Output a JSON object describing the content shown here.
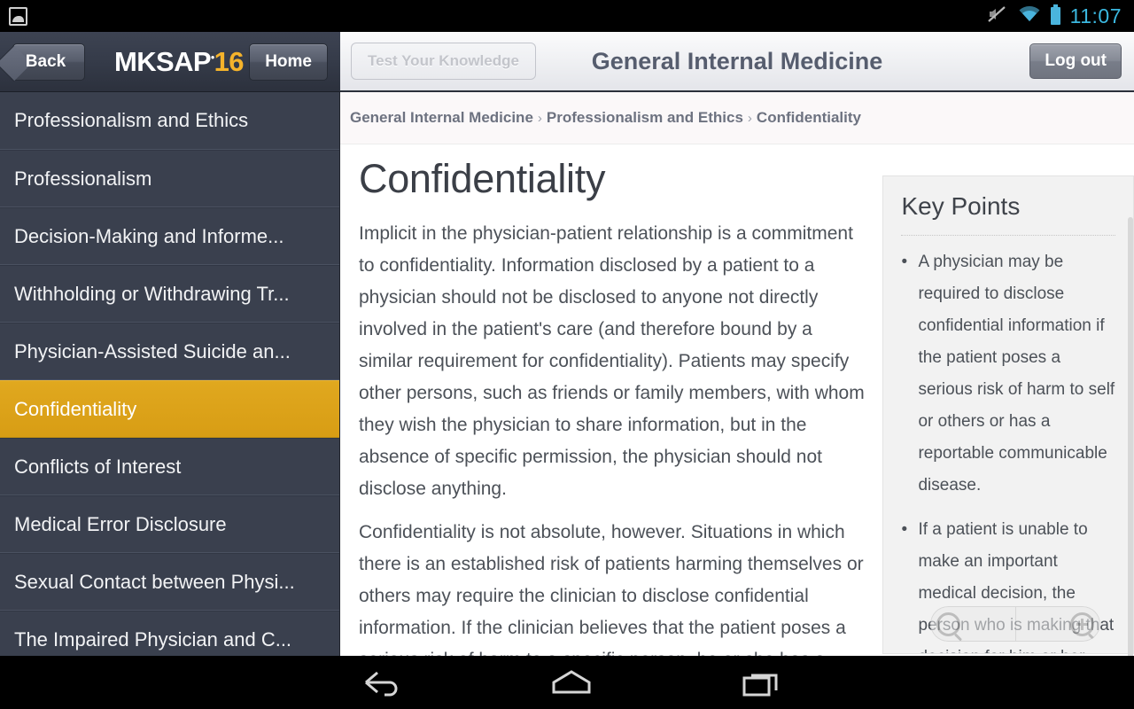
{
  "status_bar": {
    "notification_icon": "image-notification-icon",
    "vibrate_icon": "vibrate-mute-icon",
    "wifi_icon": "wifi-icon",
    "battery_icon": "battery-icon",
    "time": "11:07"
  },
  "app_bar": {
    "back_label": "Back",
    "logo_main": "MKSAP",
    "logo_tm": "•",
    "logo_edition": "16",
    "home_label": "Home",
    "test_your_knowledge_label": "Test Your Knowledge",
    "title": "General Internal Medicine",
    "logout_label": "Log out"
  },
  "sidebar": {
    "items": [
      {
        "label": "Professionalism and Ethics",
        "active": false
      },
      {
        "label": "Professionalism",
        "active": false
      },
      {
        "label": "Decision-Making and Informe...",
        "active": false
      },
      {
        "label": "Withholding or Withdrawing Tr...",
        "active": false
      },
      {
        "label": "Physician-Assisted Suicide an...",
        "active": false
      },
      {
        "label": "Confidentiality",
        "active": true
      },
      {
        "label": "Conflicts of Interest",
        "active": false
      },
      {
        "label": "Medical Error Disclosure",
        "active": false
      },
      {
        "label": "Sexual Contact between Physi...",
        "active": false
      },
      {
        "label": "The Impaired Physician and C...",
        "active": false
      }
    ]
  },
  "breadcrumb": {
    "separator": "›",
    "items": [
      "General Internal Medicine",
      "Professionalism and Ethics",
      "Confidentiality"
    ]
  },
  "article": {
    "title": "Confidentiality",
    "paragraphs": [
      "Implicit in the physician-patient relationship is a commitment to confidentiality. Information disclosed by a patient to a physician should not be disclosed to anyone not directly involved in the patient's care (and therefore bound by a similar requirement for confidentiality). Patients may specify other persons, such as friends or family members, with whom they wish the physician to share information, but in the absence of specific permission, the physician should not disclose anything.",
      "Confidentiality is not absolute, however. Situations in which there is an established risk of patients harming themselves or others may require the clinician to disclose confidential information. If the clinician believes that the patient poses a serious risk of harm to a specific person, he or she has a"
    ]
  },
  "key_points": {
    "heading": "Key Points",
    "points": [
      "A physician may be required to disclose confidential information if the patient poses a serious risk of harm to self or others or has a reportable communicable disease.",
      "If a patient is unable to make an important medical decision, the person who is making that decision for him or her must likely take a full"
    ]
  },
  "zoom_controls": {
    "zoom_out_icon": "magnifier-minus-icon",
    "zoom_in_icon": "magnifier-plus-icon"
  },
  "nav_bar": {
    "back_icon": "android-back-icon",
    "home_icon": "android-home-icon",
    "recents_icon": "android-recents-icon"
  },
  "colors": {
    "accent_gold": "#d89d14",
    "sidebar_bg": "#3a404e",
    "header_dark": "#353b49",
    "logo_gold": "#f5b32b",
    "clock_blue": "#3bb8e0"
  }
}
